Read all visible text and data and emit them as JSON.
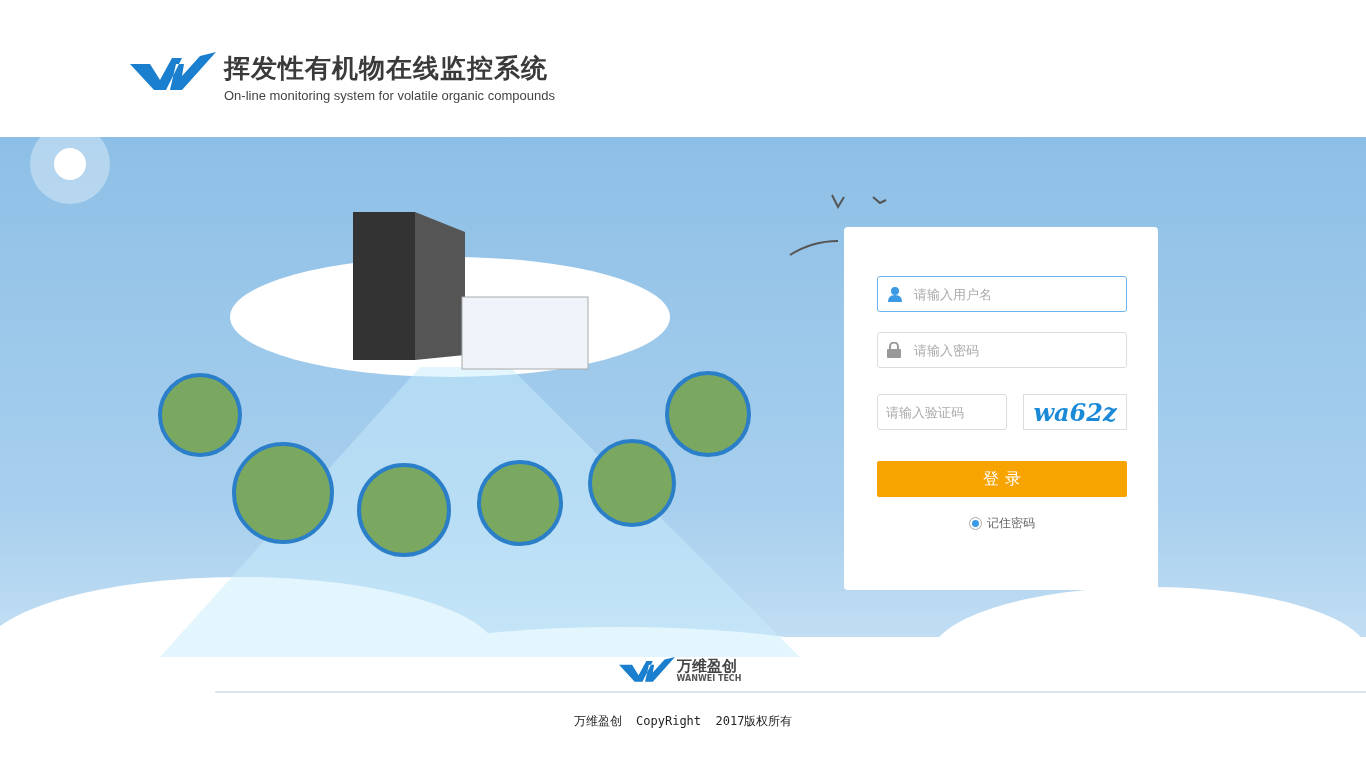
{
  "header": {
    "title": "挥发性有机物在线监控系统",
    "subtitle": "On-line monitoring system for volatile organic compounds"
  },
  "login": {
    "fields": [
      {
        "kind": "username",
        "placeholder": "请输入用户名",
        "focused": true
      },
      {
        "kind": "password",
        "placeholder": "请输入密码",
        "focused": false
      }
    ],
    "captcha": {
      "placeholder": "请输入验证码",
      "code": "wa62z"
    },
    "button": "登 录",
    "remember": {
      "label": "记住密码",
      "checked": true
    }
  },
  "footer": {
    "brand": "万维盈创",
    "brand_subtitle": "WANWEI TECH",
    "copyright": "万维盈创  CopyRight  2017版权所有"
  }
}
